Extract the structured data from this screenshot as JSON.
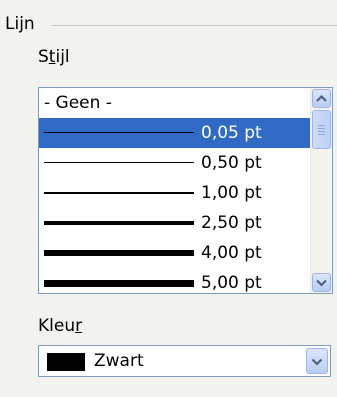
{
  "group": {
    "title": "Lijn"
  },
  "style": {
    "label": "Stijl",
    "mnemonic": "t",
    "label_rest": "ijl",
    "items": [
      {
        "label": "- Geen -"
      },
      {
        "label": "0,05 pt"
      },
      {
        "label": "0,50 pt"
      },
      {
        "label": "1,00 pt"
      },
      {
        "label": "2,50 pt"
      },
      {
        "label": "4,00 pt"
      },
      {
        "label": "5,00 pt"
      }
    ],
    "selected": "0,05 pt"
  },
  "color": {
    "label_pre": "Kleu",
    "mnemonic": "r",
    "value": "Zwart",
    "swatch_color": "#000000"
  },
  "colors": {
    "selection": "#316ac5",
    "border": "#7f9db9",
    "background": "#f2f2ef"
  }
}
